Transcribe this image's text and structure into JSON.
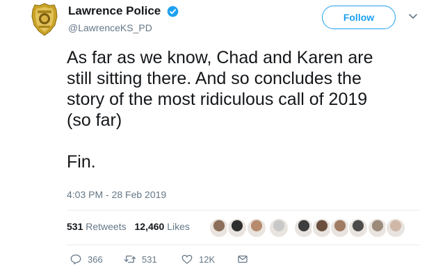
{
  "account": {
    "display_name": "Lawrence Police",
    "handle": "@LawrenceKS_PD",
    "verified_icon": "verified-badge-icon",
    "avatar_icon": "police-badge-icon"
  },
  "follow_button": {
    "label": "Follow"
  },
  "tweet": {
    "text": "As far as we know, Chad and Karen are\nstill sitting there. And so concludes the\nstory of the most ridiculous call of 2019\n(so far)\n\nFin.",
    "timestamp": "4:03 PM - 28 Feb 2019"
  },
  "stats": {
    "retweets_count": "531",
    "retweets_label": "Retweets",
    "likes_count": "12,460",
    "likes_label": "Likes"
  },
  "likers": [
    "liker-avatar",
    "liker-avatar",
    "liker-avatar",
    "liker-avatar",
    "liker-avatar",
    "liker-avatar",
    "liker-avatar",
    "liker-avatar",
    "liker-avatar",
    "liker-avatar"
  ],
  "actions": {
    "reply": {
      "icon": "reply-icon",
      "count": "366"
    },
    "retweet": {
      "icon": "retweet-icon",
      "count": "531"
    },
    "like": {
      "icon": "heart-icon",
      "count": "12K"
    },
    "message": {
      "icon": "direct-message-icon"
    }
  },
  "colors": {
    "accent": "#1da1f2",
    "text": "#14171a",
    "muted": "#657786",
    "divider": "#e6ecf0"
  }
}
